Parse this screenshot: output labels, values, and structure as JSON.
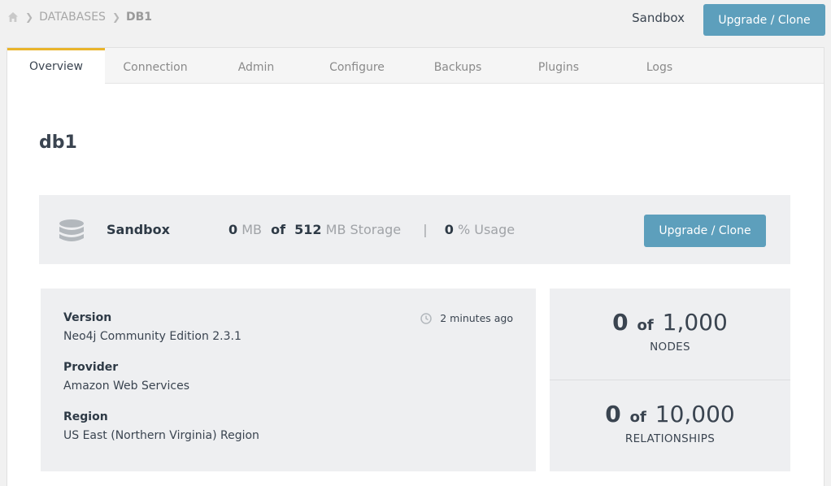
{
  "breadcrumb": {
    "items": [
      "DATABASES",
      "DB1"
    ]
  },
  "header": {
    "plan": "Sandbox",
    "upgrade_label": "Upgrade / Clone"
  },
  "tabs": [
    {
      "label": "Overview",
      "active": true
    },
    {
      "label": "Connection"
    },
    {
      "label": "Admin"
    },
    {
      "label": "Configure"
    },
    {
      "label": "Backups"
    },
    {
      "label": "Plugins"
    },
    {
      "label": "Logs"
    }
  ],
  "database": {
    "title": "db1"
  },
  "summary": {
    "icon": "database-icon",
    "plan": "Sandbox",
    "used": "0",
    "used_unit": "MB",
    "of": "of",
    "total": "512",
    "total_unit": "MB Storage",
    "separator": "|",
    "usage": "0",
    "usage_unit": "% Usage",
    "upgrade_label": "Upgrade / Clone"
  },
  "info": {
    "updated": "2 minutes ago",
    "version_label": "Version",
    "version": "Neo4j Community Edition 2.3.1",
    "provider_label": "Provider",
    "provider": "Amazon Web Services",
    "region_label": "Region",
    "region": "US East (Northern Virginia) Region"
  },
  "counts": {
    "nodes": {
      "used": "0",
      "of": "of",
      "limit": "1,000",
      "label": "NODES"
    },
    "relationships": {
      "used": "0",
      "of": "of",
      "limit": "10,000",
      "label": "RELATIONSHIPS"
    }
  },
  "colors": {
    "accent": "#5d9fbc",
    "active_tab": "#e9b42c"
  }
}
